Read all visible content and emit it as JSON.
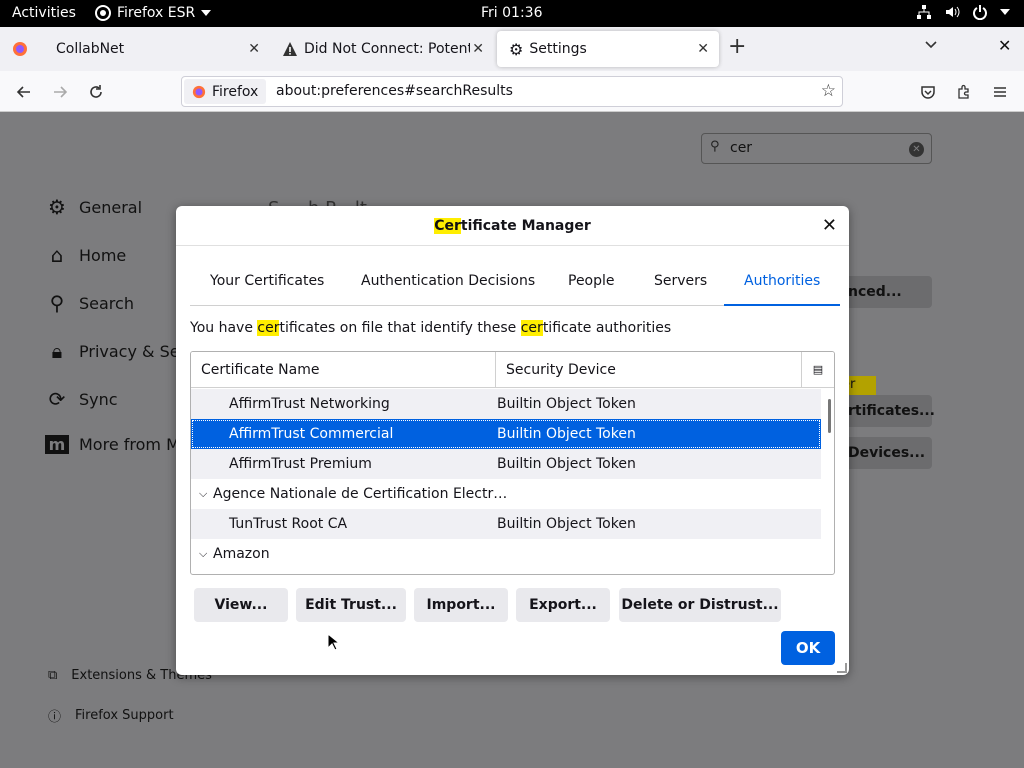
{
  "topbar": {
    "activities": "Activities",
    "app": "Firefox ESR",
    "clock": "Fri 01:36"
  },
  "tabs": [
    {
      "label": "CollabNet"
    },
    {
      "label": "Did Not Connect: Potenti"
    },
    {
      "label": "Settings"
    }
  ],
  "urlbar": {
    "identity": "Firefox",
    "url": "about:preferences#searchResults"
  },
  "prefs": {
    "search_value": "cer",
    "categories": [
      "General",
      "Home",
      "Search",
      "Privacy & Secu",
      "Sync",
      "More from Mo"
    ],
    "footer": [
      "Extensions & Themes",
      "Firefox Support"
    ],
    "bg_buttons": [
      "nced...",
      "rtificates...",
      "Devices..."
    ],
    "bg_highlight": "er",
    "heading_partial": "S     h R   lt"
  },
  "dialog": {
    "title_highlight": "Cer",
    "title_rest": "tificate Manager",
    "tabs": [
      "Your Certificates",
      "Authentication Decisions",
      "People",
      "Servers",
      "Authorities"
    ],
    "active_tab": "Authorities",
    "desc": {
      "a": "You have ",
      "b": "cer",
      "c": "tificates on file that identify these ",
      "d": "cer",
      "e": "tificate authorities"
    },
    "columns": [
      "Certificate Name",
      "Security Device"
    ],
    "rows": [
      {
        "name": "AffirmTrust Networking",
        "device": "Builtin Object Token"
      },
      {
        "name": "AffirmTrust Commercial",
        "device": "Builtin Object Token"
      },
      {
        "name": "AffirmTrust Premium",
        "device": "Builtin Object Token"
      },
      {
        "name": "Agence Nationale de Certification Electr…",
        "device": ""
      },
      {
        "name": "TunTrust Root CA",
        "device": "Builtin Object Token"
      },
      {
        "name": "Amazon",
        "device": ""
      }
    ],
    "buttons": [
      "View...",
      "Edit Trust...",
      "Import...",
      "Export...",
      "Delete or Distrust..."
    ],
    "ok": "OK"
  }
}
